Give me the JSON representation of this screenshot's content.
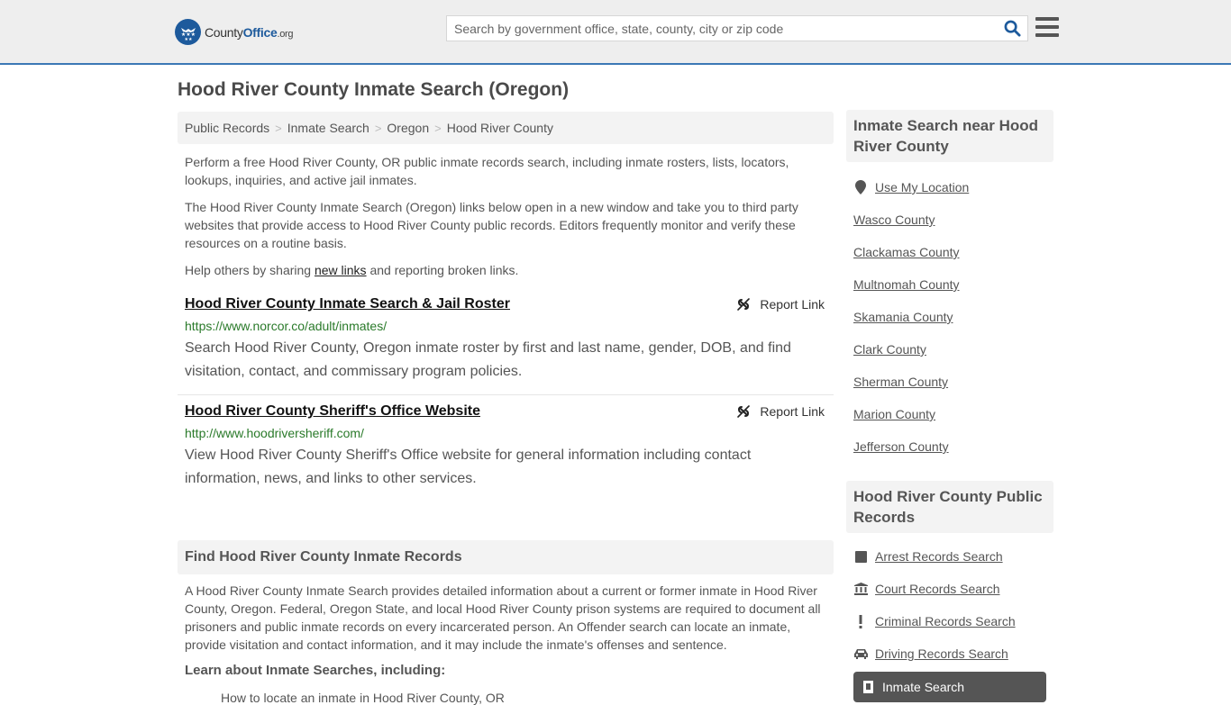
{
  "header": {
    "logo": {
      "name": "County",
      "brand": "Office",
      "tld": ".org"
    },
    "search": {
      "placeholder": "Search by government office, state, county, city or zip code",
      "value": ""
    },
    "colors": {
      "brand": "#1d5a9c",
      "accent_border": "#3b78b5"
    }
  },
  "page": {
    "title": "Hood River County Inmate Search (Oregon)"
  },
  "breadcrumb": [
    {
      "label": "Public Records"
    },
    {
      "label": "Inmate Search"
    },
    {
      "label": "Oregon"
    },
    {
      "label": "Hood River County"
    }
  ],
  "breadcrumb_separator": ">",
  "intro": {
    "p1": "Perform a free Hood River County, OR public inmate records search, including inmate rosters, lists, locators, lookups, inquiries, and active jail inmates.",
    "p2": "The Hood River County Inmate Search (Oregon) links below open in a new window and take you to third party websites that provide access to Hood River County public records. Editors frequently monitor and verify these resources on a routine basis.",
    "p3_before": "Help others by sharing ",
    "p3_link": "new links",
    "p3_after": " and reporting broken links."
  },
  "links": [
    {
      "title": "Hood River County Inmate Search & Jail Roster",
      "url": "https://www.norcor.co/adult/inmates/",
      "description": "Search Hood River County, Oregon inmate roster by first and last name, gender, DOB, and find visitation, contact, and commissary program policies.",
      "report_label": "Report Link"
    },
    {
      "title": "Hood River County Sheriff's Office Website",
      "url": "http://www.hoodriversheriff.com/",
      "description": "View Hood River County Sheriff's Office website for general information including contact information, news, and links to other services.",
      "report_label": "Report Link"
    }
  ],
  "records_section": {
    "heading": "Find Hood River County Inmate Records",
    "body": "A Hood River County Inmate Search provides detailed information about a current or former inmate in Hood River County, Oregon. Federal, Oregon State, and local Hood River County prison systems are required to document all prisoners and public inmate records on every incarcerated person. An Offender search can locate an inmate, provide visitation and contact information, and it may include the inmate's offenses and sentence.",
    "subheading": "Learn about Inmate Searches, including:",
    "partial_line": "How to locate an inmate in Hood River County, OR"
  },
  "sidebar": {
    "nearby": {
      "heading": "Inmate Search near Hood River County",
      "use_location": "Use My Location",
      "counties": [
        "Wasco County",
        "Clackamas County",
        "Multnomah County",
        "Skamania County",
        "Clark County",
        "Sherman County",
        "Marion County",
        "Jefferson County"
      ]
    },
    "public_records": {
      "heading": "Hood River County Public Records",
      "items": [
        {
          "label": "Arrest Records Search",
          "icon": "square-icon"
        },
        {
          "label": "Court Records Search",
          "icon": "courthouse-icon"
        },
        {
          "label": "Criminal Records Search",
          "icon": "exclamation-icon"
        },
        {
          "label": "Driving Records Search",
          "icon": "car-icon"
        }
      ],
      "active": {
        "label": "Inmate Search",
        "icon": "door-icon"
      }
    }
  }
}
